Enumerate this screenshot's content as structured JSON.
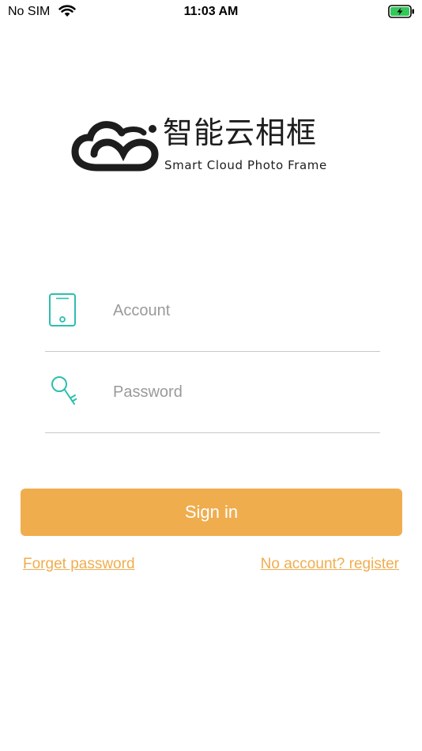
{
  "status_bar": {
    "carrier": "No SIM",
    "time": "11:03 AM",
    "wifi_icon": "wifi-icon",
    "battery_icon": "battery-charging-icon",
    "battery_color": "#34c759"
  },
  "logo": {
    "title_cn": "智能云相框",
    "title_en": "Smart Cloud Photo Frame",
    "icon": "cloud-logo-icon"
  },
  "form": {
    "account": {
      "placeholder": "Account",
      "value": "",
      "icon": "tablet-icon"
    },
    "password": {
      "placeholder": "Password",
      "value": "",
      "icon": "key-icon"
    },
    "icon_color": "#2bbfae"
  },
  "actions": {
    "sign_in_label": "Sign in",
    "forget_password_label": "Forget password",
    "register_label": "No account? register",
    "accent_color": "#f0ad4e"
  }
}
